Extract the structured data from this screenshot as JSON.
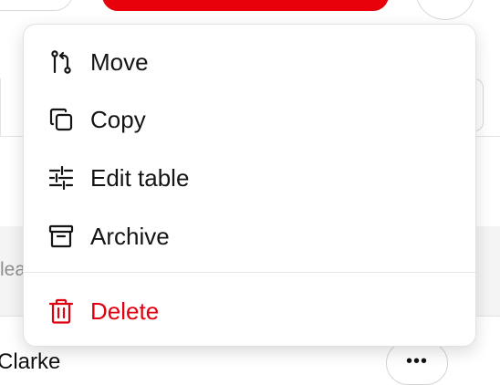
{
  "background": {
    "header_fragment": "lea",
    "name_fragment": "Clarke",
    "more_button_label": "•••"
  },
  "menu": {
    "items": [
      {
        "label": "Move",
        "icon": "git-move-icon"
      },
      {
        "label": "Copy",
        "icon": "copy-icon"
      },
      {
        "label": "Edit table",
        "icon": "sliders-icon"
      },
      {
        "label": "Archive",
        "icon": "archive-icon"
      }
    ],
    "danger_item": {
      "label": "Delete",
      "icon": "trash-icon"
    }
  },
  "colors": {
    "danger": "#e0000f",
    "primary_button": "#e8000b",
    "text": "#141414"
  }
}
